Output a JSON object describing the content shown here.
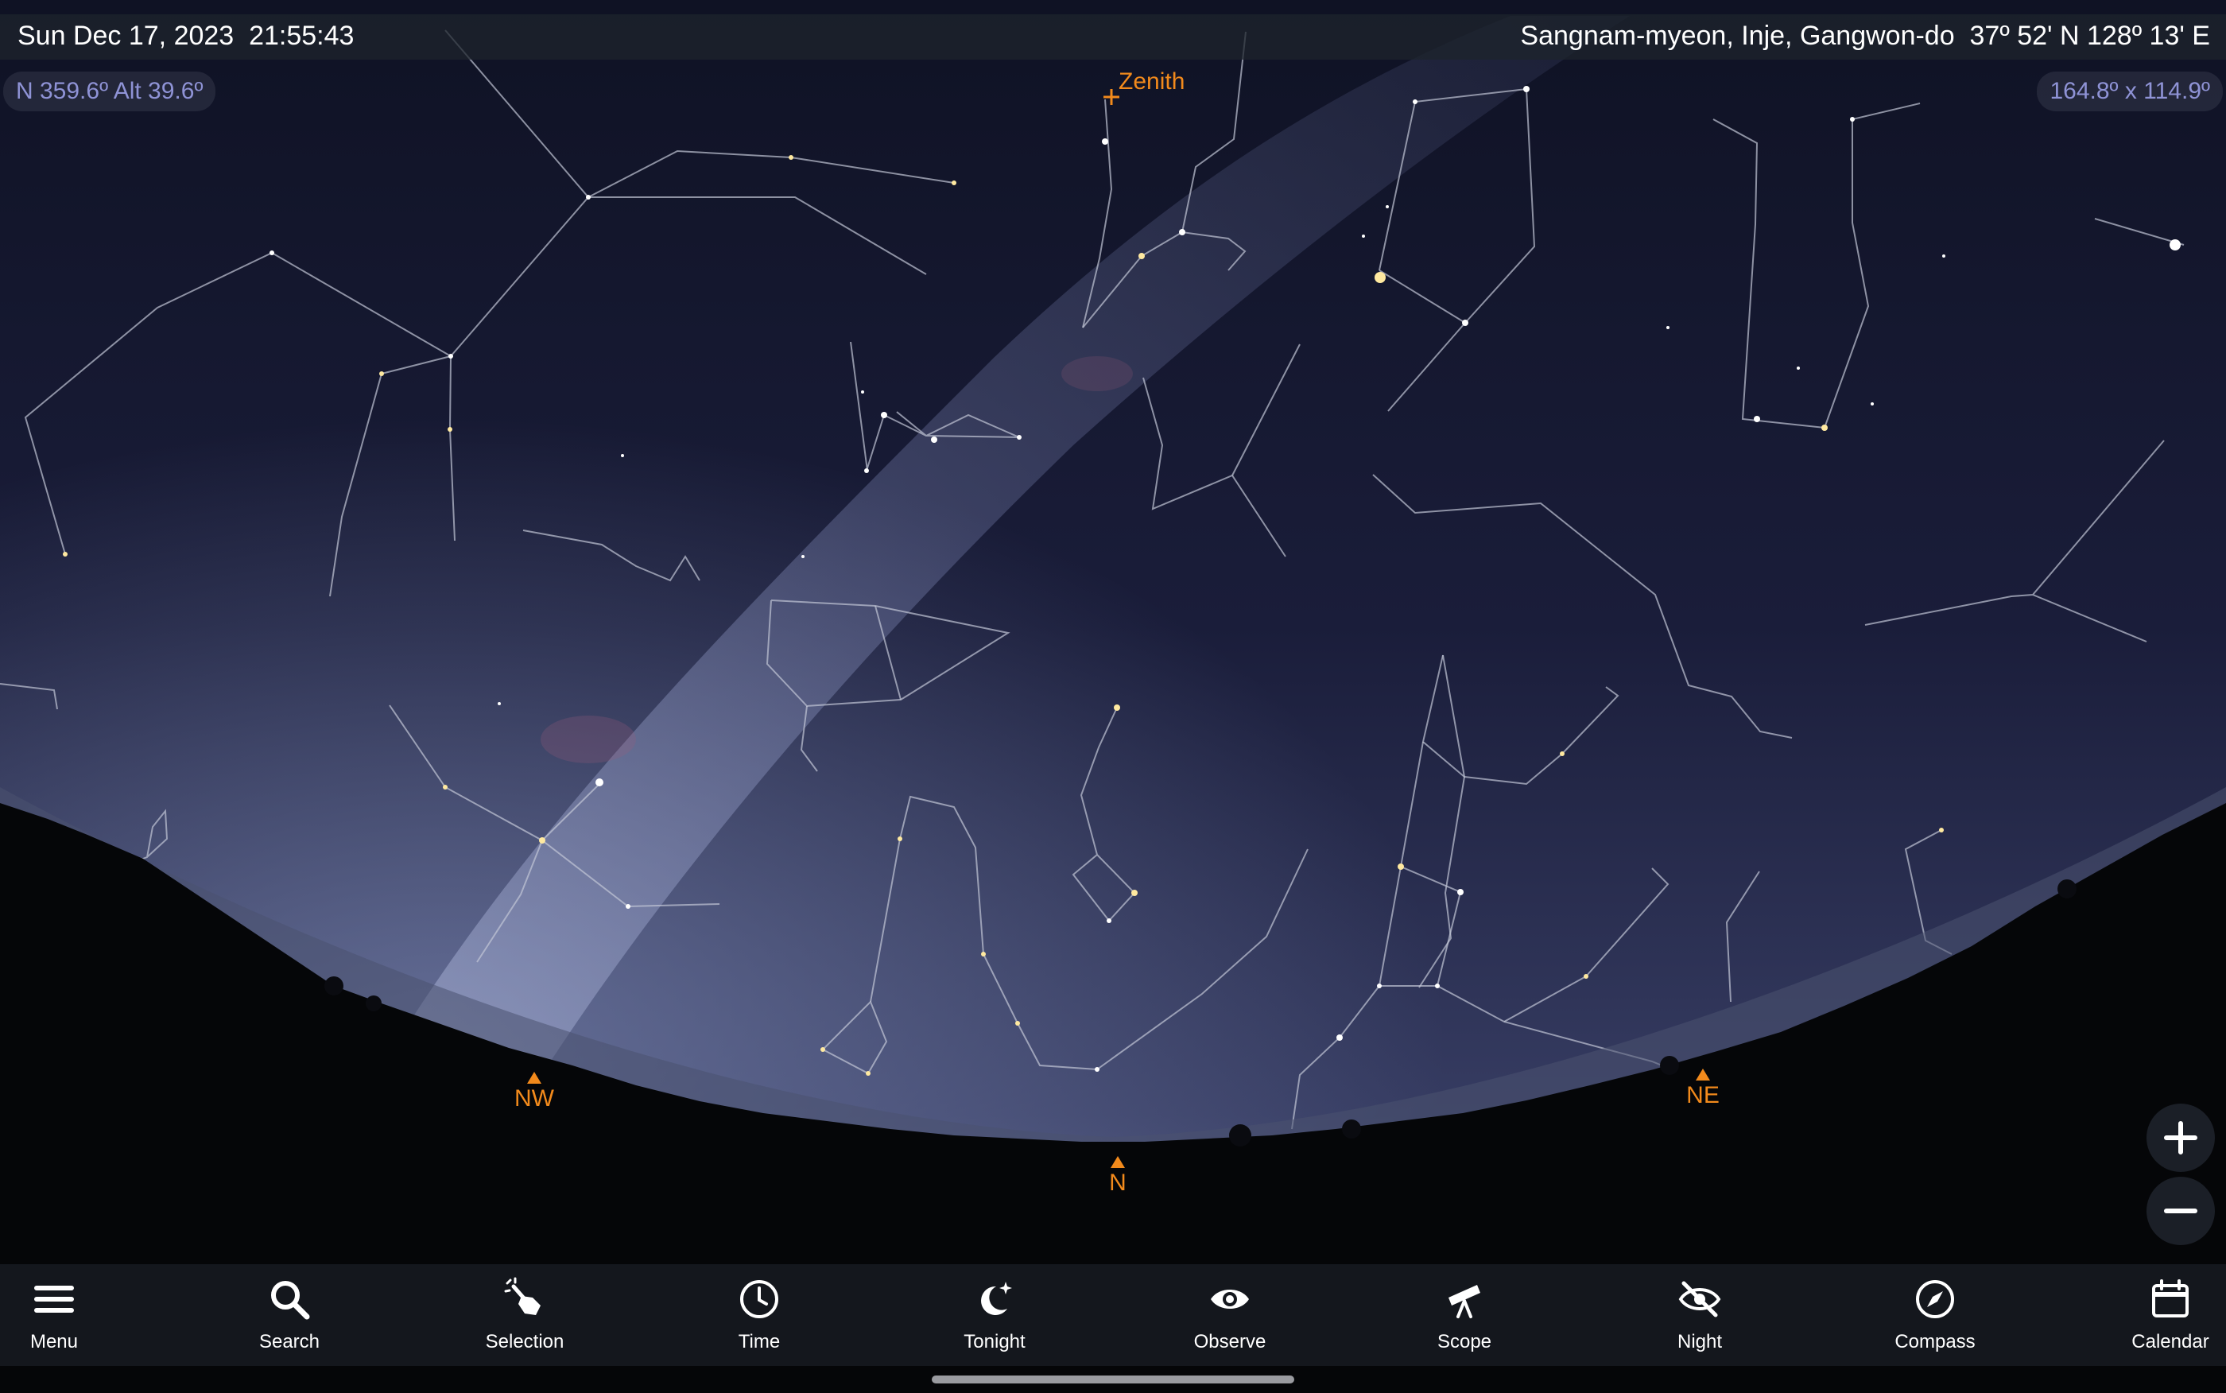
{
  "top_bar": {
    "date_time": "Sun Dec 17, 2023  21:55:43",
    "location": "Sangnam-myeon, Inje, Gangwon-do  37º 52' N 128º 13' E"
  },
  "view_info": {
    "direction": "N 359.6º Alt 39.6º",
    "field_of_view": "164.8º x 114.9º"
  },
  "sky_labels": {
    "zenith": "Zenith"
  },
  "compass_markers": {
    "nw": "NW",
    "n": "N",
    "ne": "NE"
  },
  "colors": {
    "accent": "#f28a1c",
    "info_text": "#8f93d6",
    "toolbar_bg": "#14171d"
  },
  "zoom": {
    "in_icon": "plus-icon",
    "out_icon": "minus-icon"
  },
  "toolbar": {
    "items": [
      {
        "label": "Menu",
        "icon": "hamburger-icon"
      },
      {
        "label": "Search",
        "icon": "magnifier-icon"
      },
      {
        "label": "Selection",
        "icon": "pointing-hand-icon"
      },
      {
        "label": "Time",
        "icon": "clock-icon"
      },
      {
        "label": "Tonight",
        "icon": "moon-star-icon"
      },
      {
        "label": "Observe",
        "icon": "eye-icon"
      },
      {
        "label": "Scope",
        "icon": "telescope-icon"
      },
      {
        "label": "Night",
        "icon": "eye-slash-icon"
      },
      {
        "label": "Compass",
        "icon": "compass-icon"
      },
      {
        "label": "Calendar",
        "icon": "calendar-icon"
      }
    ]
  }
}
